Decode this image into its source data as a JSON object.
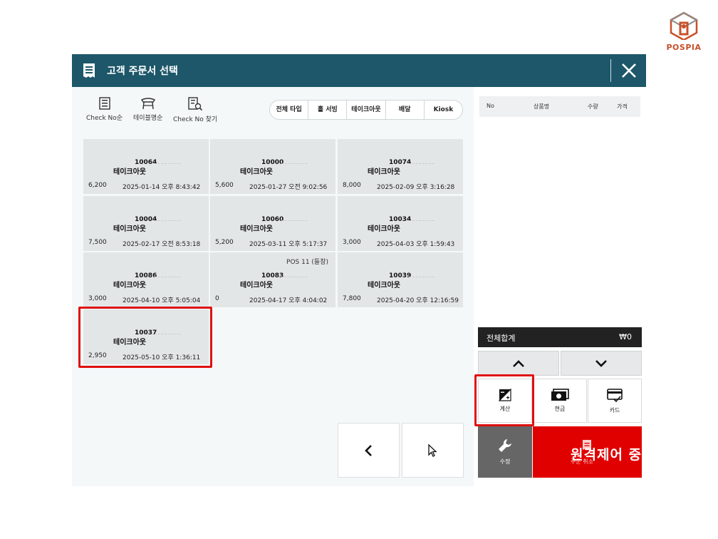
{
  "brand": {
    "name": "POSPIA",
    "color": "#c8502a"
  },
  "dialog": {
    "title": "고객 주문서 선택",
    "header_color": "#1d5769",
    "close_icon": "close-icon"
  },
  "toolbar": {
    "tools": [
      {
        "label": "Check No순",
        "icon": "receipt-icon"
      },
      {
        "label": "테이블명순",
        "icon": "table-icon"
      },
      {
        "label": "Check No 찾기",
        "icon": "search-receipt-icon"
      }
    ],
    "filters": [
      "전체 타입",
      "홀 서빙",
      "테이크아웃",
      "배달",
      "Kiosk"
    ]
  },
  "orders": [
    {
      "no": "10064",
      "type": "테이크아웃",
      "amount": "6,200",
      "datetime": "2025-01-14 오후 8:43:42",
      "pos": ""
    },
    {
      "no": "10000",
      "type": "테이크아웃",
      "amount": "5,600",
      "datetime": "2025-01-27 오전 9:02:56",
      "pos": ""
    },
    {
      "no": "10074",
      "type": "테이크아웃",
      "amount": "8,000",
      "datetime": "2025-02-09 오후 3:16:28",
      "pos": ""
    },
    {
      "no": "10004",
      "type": "테이크아웃",
      "amount": "7,500",
      "datetime": "2025-02-17 오전 8:53:18",
      "pos": ""
    },
    {
      "no": "10060",
      "type": "테이크아웃",
      "amount": "5,200",
      "datetime": "2025-03-11 오후 5:17:37",
      "pos": ""
    },
    {
      "no": "10034",
      "type": "테이크아웃",
      "amount": "3,000",
      "datetime": "2025-04-03 오후 1:59:43",
      "pos": ""
    },
    {
      "no": "10086",
      "type": "테이크아웃",
      "amount": "3,000",
      "datetime": "2025-04-10 오후 5:05:04",
      "pos": ""
    },
    {
      "no": "10083",
      "type": "테이크아웃",
      "amount": "0",
      "datetime": "2025-04-17 오후 4:04:02",
      "pos": "POS 11 (들창)"
    },
    {
      "no": "10039",
      "type": "테이크아웃",
      "amount": "7,800",
      "datetime": "2025-04-20 오후 12:16:59",
      "pos": ""
    },
    {
      "no": "10037",
      "type": "테이크아웃",
      "amount": "2,950",
      "datetime": "2025-05-10 오후 1:36:11",
      "pos": ""
    }
  ],
  "item_list": {
    "columns": [
      "No",
      "상품명",
      "수량",
      "가격"
    ]
  },
  "summary": {
    "total_label": "전체합계",
    "total_value": "₩0"
  },
  "actions": {
    "calc_label": "계산",
    "cash_label": "현금",
    "card_label": "카드",
    "edit_label": "수정",
    "cancel_label": "주문 취소",
    "remote_overlay": "원격제어 중",
    "cancel_color": "#e00000",
    "highlight_color": "#e01010"
  }
}
